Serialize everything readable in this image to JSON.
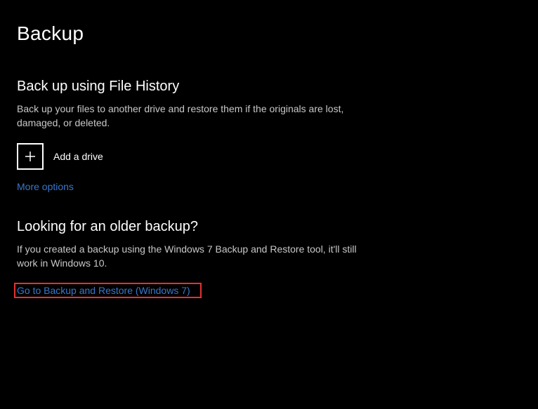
{
  "page": {
    "title": "Backup"
  },
  "file_history": {
    "heading": "Back up using File History",
    "description": "Back up your files to another drive and restore them if the originals are lost, damaged, or deleted.",
    "add_drive_label": "Add a drive",
    "more_options_label": "More options"
  },
  "older_backup": {
    "heading": "Looking for an older backup?",
    "description": "If you created a backup using the Windows 7 Backup and Restore tool, it'll still work in Windows 10.",
    "link_label": "Go to Backup and Restore (Windows 7)"
  },
  "colors": {
    "link": "#3a77c9",
    "highlight": "#e43232"
  }
}
